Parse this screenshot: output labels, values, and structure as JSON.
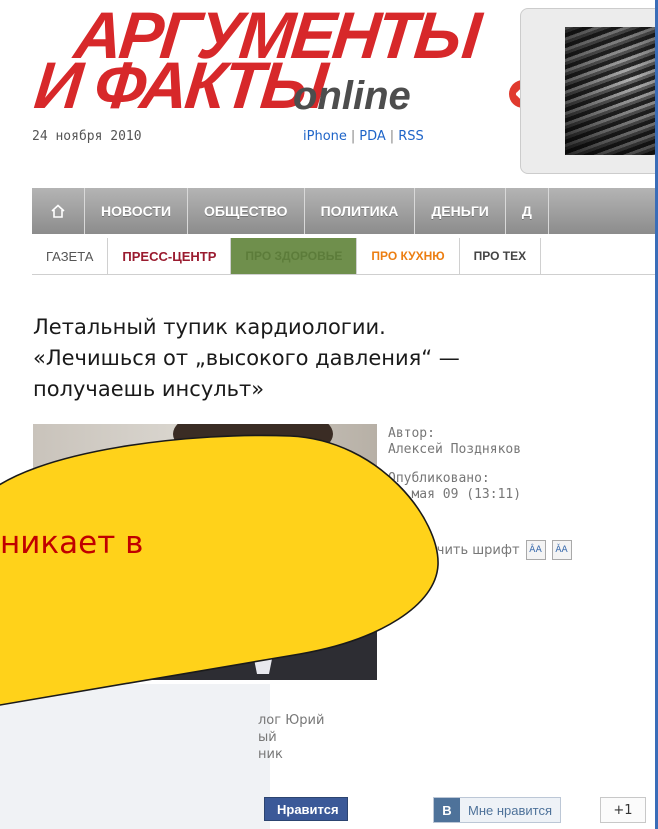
{
  "header": {
    "logo_line1": "АРГУМЕНТЫ",
    "logo_line2": "И ФАКТЫ",
    "logo_online": "online",
    "date": "24 ноября 2010",
    "links": [
      "iPhone",
      "PDA",
      "RSS"
    ]
  },
  "nav": {
    "home_icon": "home-icon",
    "items": [
      "НОВОСТИ",
      "ОБЩЕСТВО",
      "ПОЛИТИКА",
      "ДЕНЬГИ",
      "Д"
    ]
  },
  "subnav": {
    "items": [
      "ГАЗЕТА",
      "ПРЕСС-ЦЕНТР",
      "ПРО ЗДОРОВЬЕ",
      "ПРО КУХНЮ",
      "ПРО ТЕХ"
    ]
  },
  "article": {
    "headline": [
      "Летальный тупик кардиологии.",
      "«Лечишься от „высокого давления“ —",
      "получаешь инсульт»"
    ],
    "author_label": "Автор:",
    "author_name": "Алексей Поздняков",
    "published_label": "Опубликовано:",
    "published_date": "27 мая 09 (13:11)",
    "font_size_label": "личить шрифт",
    "font_increase_icon": "font-increase-icon",
    "font_decrease_icon": "font-decrease-icon",
    "caption": [
      "лог Юрий",
      "ый",
      "ник"
    ]
  },
  "overlay": {
    "callout_text": "никает в"
  },
  "social": {
    "fb_label": "Нравится",
    "vk_icon": "В",
    "vk_label": "Мне нравится",
    "plusone_label": "+1"
  },
  "colors": {
    "brand_red": "#d7282a",
    "link_blue": "#1e64c8",
    "callout_yellow": "#ffd21a",
    "callout_text": "#c00000"
  }
}
